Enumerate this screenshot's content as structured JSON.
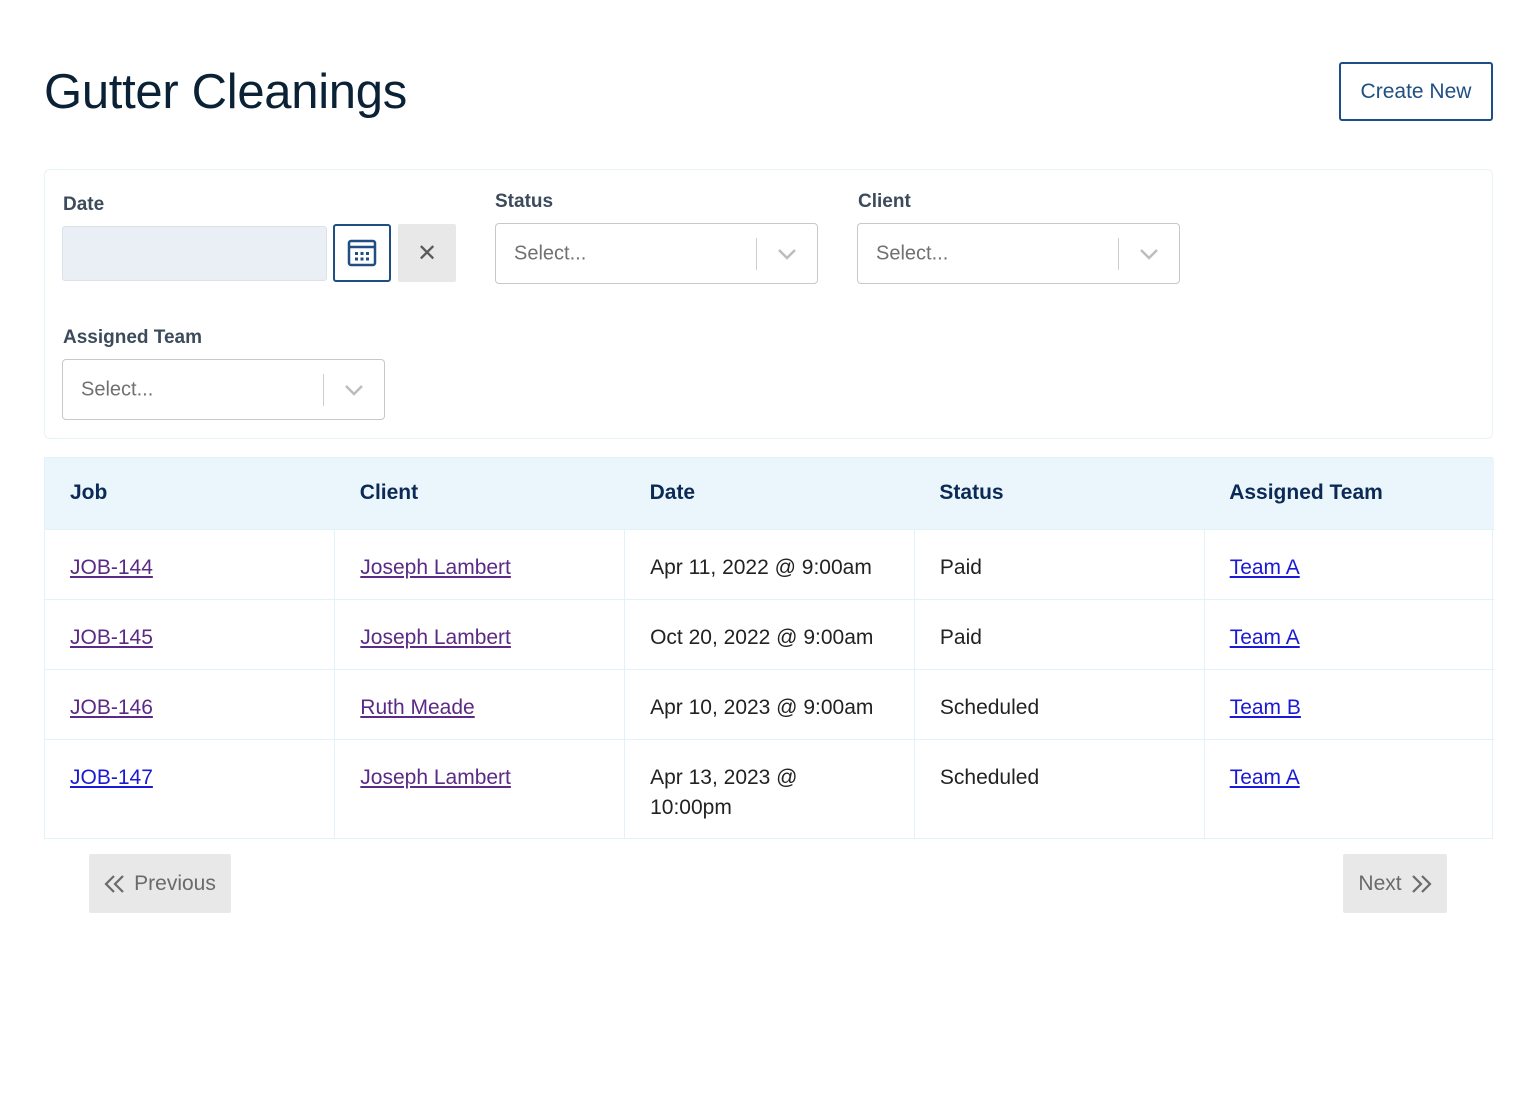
{
  "header": {
    "title": "Gutter Cleanings",
    "create_label": "Create New"
  },
  "filters": {
    "date_label": "Date",
    "status_label": "Status",
    "client_label": "Client",
    "team_label": "Assigned Team",
    "status_placeholder": "Select...",
    "client_placeholder": "Select...",
    "team_placeholder": "Select...",
    "clear_glyph": "✕"
  },
  "table": {
    "columns": [
      "Job",
      "Client",
      "Date",
      "Status",
      "Assigned Team"
    ],
    "rows": [
      {
        "job": "JOB-144",
        "client": "Joseph Lambert",
        "date": "Apr 11, 2022 @ 9:00am",
        "status": "Paid",
        "team": "Team A"
      },
      {
        "job": "JOB-145",
        "client": "Joseph Lambert",
        "date": "Oct 20, 2022 @ 9:00am",
        "status": "Paid",
        "team": "Team A"
      },
      {
        "job": "JOB-146",
        "client": "Ruth Meade",
        "date": "Apr 10, 2023 @ 9:00am",
        "status": "Scheduled",
        "team": "Team B"
      },
      {
        "job": "JOB-147",
        "client": "Joseph Lambert",
        "date": "Apr 13, 2023 @ 10:00pm",
        "status": "Scheduled",
        "team": "Team A"
      }
    ]
  },
  "pagination": {
    "previous_label": "Previous",
    "next_label": "Next"
  },
  "colors": {
    "primary": "#1f4f82",
    "header_bg": "#eaf6fb",
    "link_visited": "#5b2a86",
    "link": "#1a1ad4"
  }
}
